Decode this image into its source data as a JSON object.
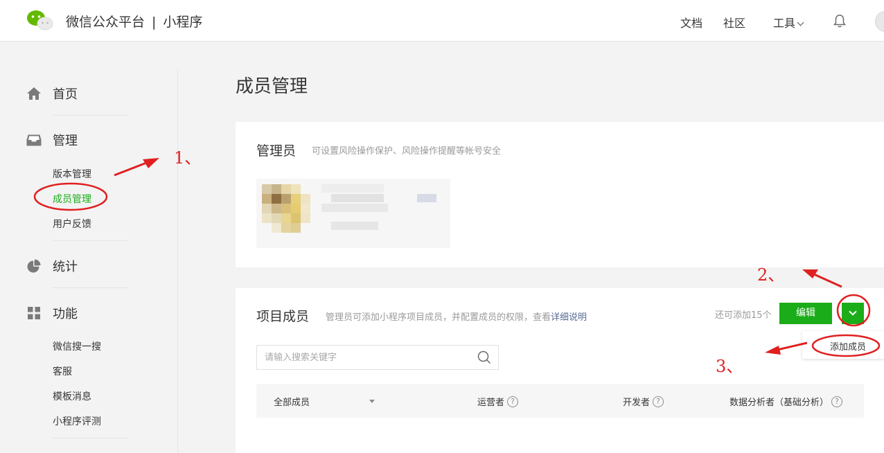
{
  "header": {
    "brand": "微信公众平台",
    "separator": "|",
    "product": "小程序",
    "nav": {
      "docs": "文档",
      "community": "社区",
      "tools": "工具"
    }
  },
  "sidebar": {
    "home": "首页",
    "manage": "管理",
    "manage_items": [
      "版本管理",
      "成员管理",
      "用户反馈"
    ],
    "stats": "统计",
    "features": "功能",
    "feature_items": [
      "微信搜一搜",
      "客服",
      "模板消息",
      "小程序评测"
    ]
  },
  "main": {
    "title": "成员管理",
    "admin": {
      "title": "管理员",
      "desc": "可设置风险操作保护、风险操作提醒等帐号安全"
    },
    "members": {
      "title": "项目成员",
      "desc": "管理员可添加小程序项目成员，并配置成员的权限，查看",
      "desc_link": "详细说明",
      "remaining": "还可添加15个",
      "edit_button": "编辑",
      "search_placeholder": "请输入搜索关键字",
      "columns": {
        "filter": "全部成员",
        "operator": "运营者",
        "developer": "开发者",
        "analyst": "数据分析者（基础分析）"
      },
      "help_mark": "?",
      "dropdown_item": "添加成员"
    }
  },
  "annotations": {
    "step1": "1、",
    "step2": "2、",
    "step3": "3、",
    "color": "#e02020"
  },
  "colors": {
    "accent": "#1aad19",
    "link": "#576b95"
  }
}
